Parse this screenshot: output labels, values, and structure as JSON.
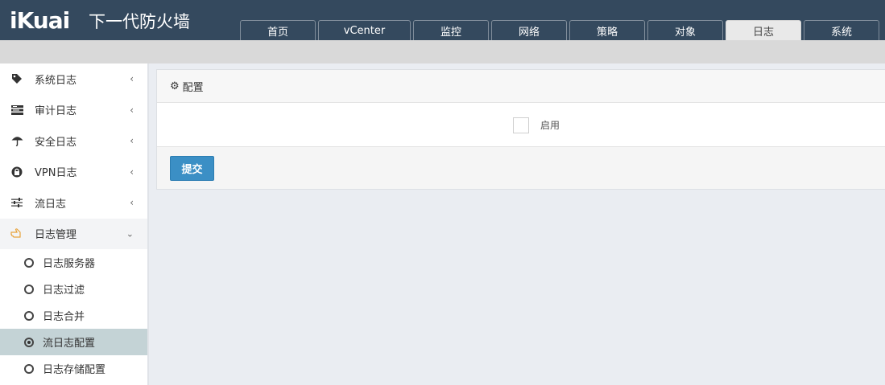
{
  "header": {
    "logo": "iKuai",
    "title": "下一代防火墙",
    "tabs": [
      {
        "label": "首页"
      },
      {
        "label": "vCenter"
      },
      {
        "label": "监控"
      },
      {
        "label": "网络"
      },
      {
        "label": "策略"
      },
      {
        "label": "对象"
      },
      {
        "label": "日志",
        "active": true
      },
      {
        "label": "系统"
      }
    ]
  },
  "sidebar": {
    "items": [
      {
        "label": "系统日志",
        "icon": "tag-icon"
      },
      {
        "label": "审计日志",
        "icon": "list-icon"
      },
      {
        "label": "安全日志",
        "icon": "umbrella-icon"
      },
      {
        "label": "VPN日志",
        "icon": "lock-icon"
      },
      {
        "label": "流日志",
        "icon": "sliders-icon"
      },
      {
        "label": "日志管理",
        "icon": "hand-pointer-icon",
        "open": true
      }
    ],
    "sub_items": [
      {
        "label": "日志服务器"
      },
      {
        "label": "日志过滤"
      },
      {
        "label": "日志合并"
      },
      {
        "label": "流日志配置",
        "active": true
      },
      {
        "label": "日志存储配置"
      }
    ]
  },
  "panel": {
    "title": "配置",
    "enable_label": "启用",
    "enable_checked": false,
    "submit_label": "提交"
  },
  "colors": {
    "header_bg": "#34495e",
    "accent": "#3b8fc5",
    "active_sub_bg": "#c4d3d6",
    "open_icon": "#e8a33c"
  }
}
